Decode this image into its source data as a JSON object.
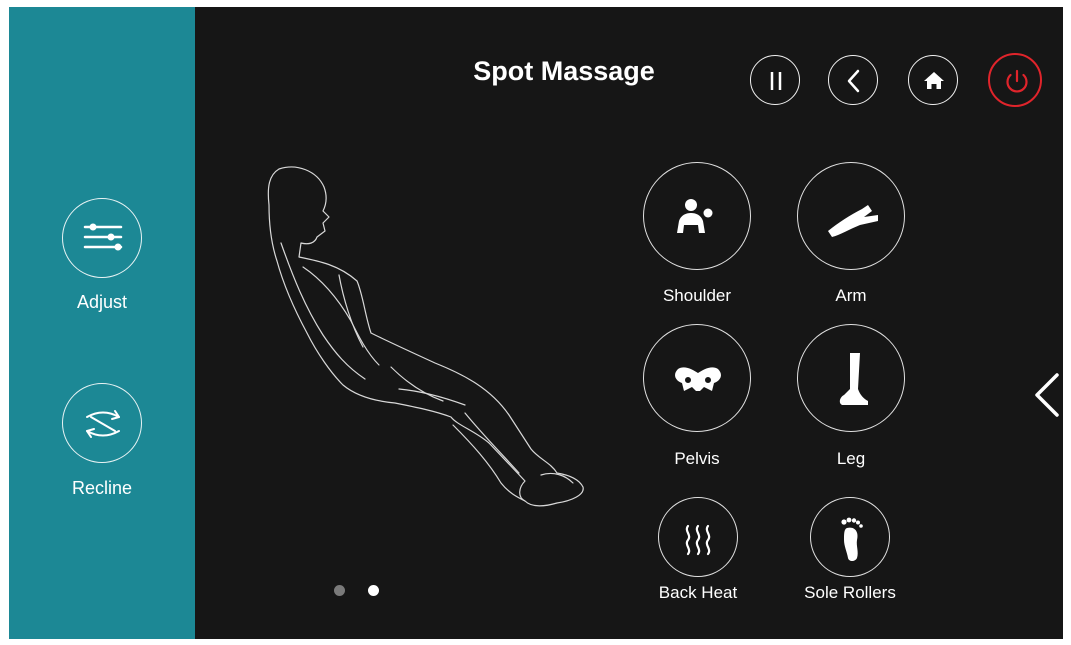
{
  "sidebar": {
    "items": [
      {
        "label": "Adjust",
        "icon": "sliders-icon"
      },
      {
        "label": "Recline",
        "icon": "recline-arrows-icon"
      }
    ]
  },
  "header": {
    "title": "Spot Massage",
    "buttons": [
      {
        "name": "pause",
        "icon": "pause-icon"
      },
      {
        "name": "back",
        "icon": "chevron-left-icon"
      },
      {
        "name": "home",
        "icon": "home-icon"
      },
      {
        "name": "power",
        "icon": "power-icon",
        "color": "#e0242b"
      }
    ]
  },
  "modes": [
    {
      "label": "Shoulder",
      "icon": "shoulder-icon"
    },
    {
      "label": "Arm",
      "icon": "arm-icon"
    },
    {
      "label": "Pelvis",
      "icon": "pelvis-icon"
    },
    {
      "label": "Leg",
      "icon": "leg-icon"
    },
    {
      "label": "Back Heat",
      "icon": "heat-waves-icon"
    },
    {
      "label": "Sole Rollers",
      "icon": "foot-icon"
    }
  ],
  "pager": {
    "pages": 2,
    "active_page": 2
  },
  "colors": {
    "sidebar": "#1c8895",
    "background": "#161616",
    "power": "#e0242b",
    "dot_inactive": "#7a7a7a",
    "dot_active": "#ffffff"
  }
}
